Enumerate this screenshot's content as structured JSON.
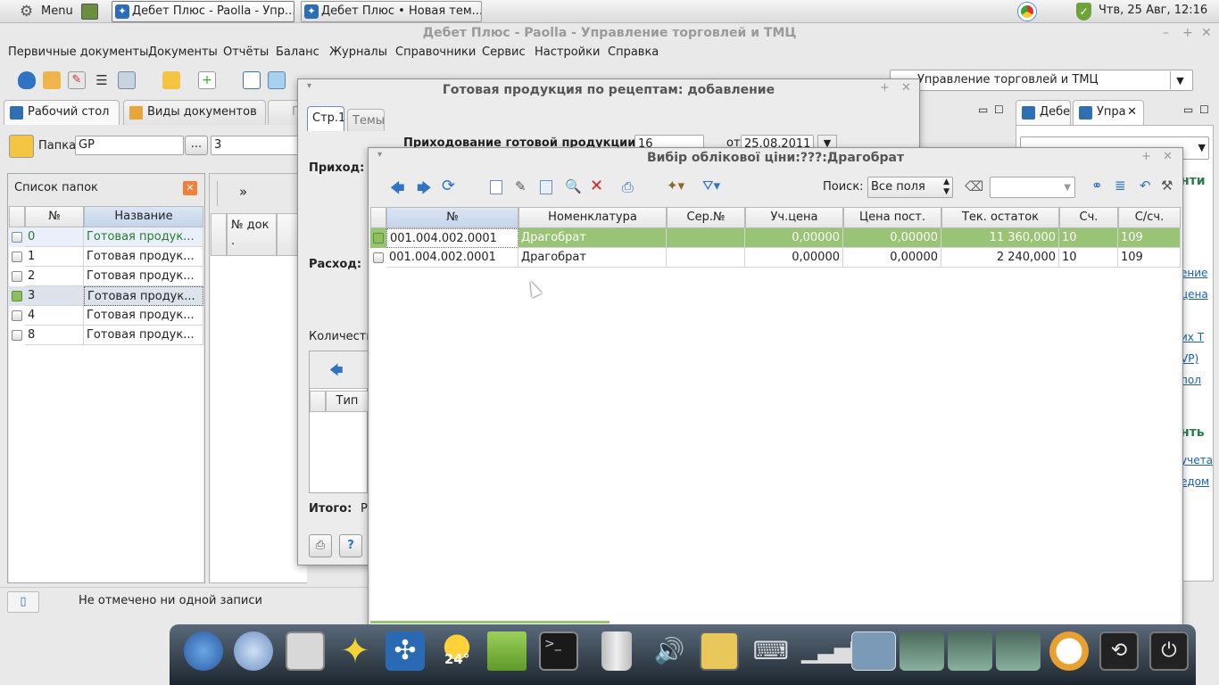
{
  "topbar": {
    "menu_label": "Menu",
    "tasks": [
      "Дебет Плюс - Paolla - Упр...",
      "Дебет Плюс • Новая тем..."
    ],
    "clock": "Чтв, 25 Авг, 12:16"
  },
  "app_title": "Дебет Плюс - Paolla - Управление торговлей и ТМЦ",
  "menu": [
    "Первичные документы",
    "Документы",
    "Отчёты",
    "Баланс",
    "Журналы",
    "Справочники",
    "Сервис",
    "Настройки",
    "Справка"
  ],
  "config_select": "Управление торговлей и ТМЦ",
  "left_tabs": [
    "Рабочий стол",
    "Виды документов",
    "Го"
  ],
  "right_tabs": [
    "Дебет",
    "Упра"
  ],
  "folder_bar": {
    "label": "Папка",
    "value": "GP",
    "ellipsis": "...",
    "value2": "3"
  },
  "folders": {
    "title": "Список папок",
    "columns": [
      "№",
      "Название"
    ],
    "rows": [
      {
        "num": "0",
        "name": "Готовая продук..."
      },
      {
        "num": "1",
        "name": "Готовая продук..."
      },
      {
        "num": "2",
        "name": "Готовая продук..."
      },
      {
        "num": "3",
        "name": "Готовая продук..."
      },
      {
        "num": "4",
        "name": "Готовая продук..."
      },
      {
        "num": "8",
        "name": "Готовая продук..."
      }
    ]
  },
  "doclist": {
    "more": "»",
    "col_num": "№ док",
    "col_num2": "."
  },
  "status": "Не отмечено ни одной записи",
  "dialog": {
    "title": "Готовая продукция по рецептам: добавление",
    "tabs": [
      "Стр.1",
      "Темы"
    ],
    "doc_label": "Приходование готовой продукции №",
    "doc_num": "16",
    "date_label": "от",
    "date": "25.08.2011",
    "income": "Приход:",
    "expense": "Расход:",
    "quantity": "Количеств",
    "col_type": "Тип",
    "total": "Итого:",
    "total_val": "Р"
  },
  "picker": {
    "title": "Вибір облікової ціни:???:Драгобрат",
    "search_label": "Поиск:",
    "search_mode": "Все поля",
    "columns": [
      "№",
      "Номенклатура",
      "Сер.№",
      "Уч.цена",
      "Цена пост.",
      "Тек. остаток",
      "Сч.",
      "С/сч."
    ],
    "rows": [
      {
        "num": "001.004.002.0001",
        "name": "Драгобрат",
        "serial": "",
        "price": "0,00000",
        "supplier_price": "0,00000",
        "stock": "11 360,000",
        "acc": "10",
        "subacc": "109"
      },
      {
        "num": "001.004.002.0001",
        "name": "Драгобрат",
        "serial": "",
        "price": "0,00000",
        "supplier_price": "0,00000",
        "stock": "2 240,000",
        "acc": "10",
        "subacc": "109"
      }
    ]
  },
  "right_panel_links": [
    "нти",
    "ение",
    "цена",
    "их Т",
    "VP)",
    "пол",
    "нть",
    "учета",
    "едом"
  ],
  "dock": {
    "weather_temp": "24°"
  }
}
